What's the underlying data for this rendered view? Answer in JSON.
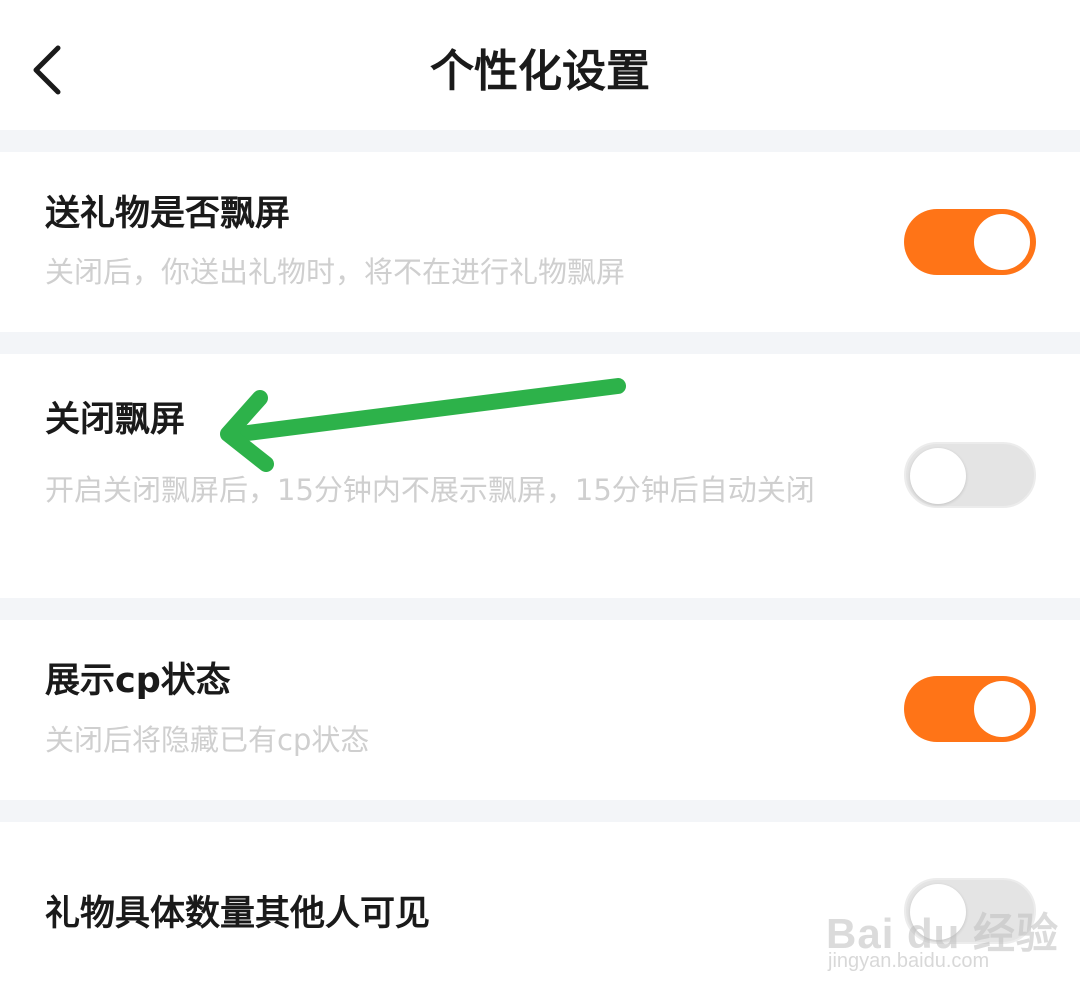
{
  "header": {
    "title": "个性化设置",
    "back_icon": "chevron-left-icon"
  },
  "settings": [
    {
      "title": "送礼物是否飘屏",
      "description": "关闭后，你送出礼物时，将不在进行礼物飘屏",
      "enabled": true
    },
    {
      "title": "关闭飘屏",
      "description": "开启关闭飘屏后，15分钟内不展示飘屏，15分钟后自动关闭",
      "enabled": false
    },
    {
      "title": "展示cp状态",
      "description": "关闭后将隐藏已有cp状态",
      "enabled": true
    },
    {
      "title": "礼物具体数量其他人可见",
      "description": "",
      "enabled": false
    }
  ],
  "annotation": {
    "arrow_color": "#2db24a",
    "icon": "arrow-left-annotation-icon"
  },
  "watermark": {
    "logo": "Bai du 经验",
    "url": "jingyan.baidu.com"
  },
  "colors": {
    "toggle_on": "#ff7417",
    "toggle_off": "#e4e4e4",
    "separator": "#f3f5f8",
    "description_text": "#cfcfcf"
  }
}
